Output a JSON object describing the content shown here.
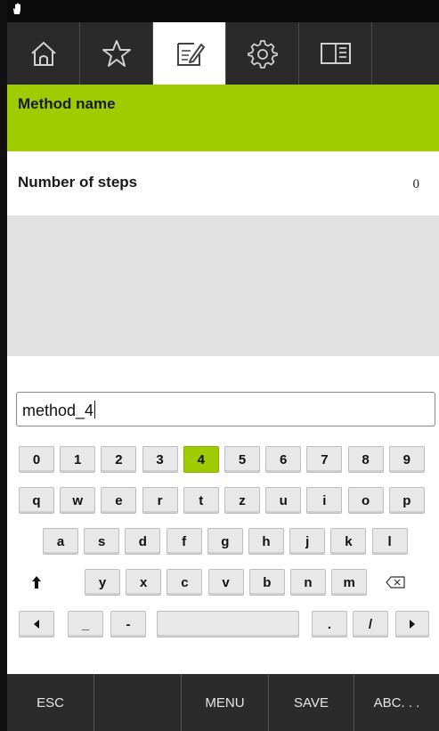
{
  "tabs": [
    {
      "icon": "home-icon"
    },
    {
      "icon": "star-icon"
    },
    {
      "icon": "edit-icon"
    },
    {
      "icon": "gear-icon"
    },
    {
      "icon": "book-icon"
    }
  ],
  "active_tab": 2,
  "method_name": {
    "label": "Method name"
  },
  "number_of_steps": {
    "label": "Number of steps",
    "value": "0"
  },
  "input": {
    "value": "method_4"
  },
  "keyboard": {
    "row_digits": [
      "0",
      "1",
      "2",
      "3",
      "4",
      "5",
      "6",
      "7",
      "8",
      "9"
    ],
    "highlighted_key": "4",
    "row_q": [
      "q",
      "w",
      "e",
      "r",
      "t",
      "z",
      "u",
      "i",
      "o",
      "p"
    ],
    "row_a": [
      "a",
      "s",
      "d",
      "f",
      "g",
      "h",
      "j",
      "k",
      "l"
    ],
    "row_y": [
      "y",
      "x",
      "c",
      "v",
      "b",
      "n",
      "m"
    ],
    "underscore": "_",
    "dash": "-",
    "dot": ".",
    "slash": "/"
  },
  "bottom": {
    "esc": "ESC",
    "menu": "MENU",
    "save": "SAVE",
    "abc": "ABC. . ."
  },
  "colors": {
    "accent": "#9fcc00",
    "dark": "#2b2b2b"
  }
}
